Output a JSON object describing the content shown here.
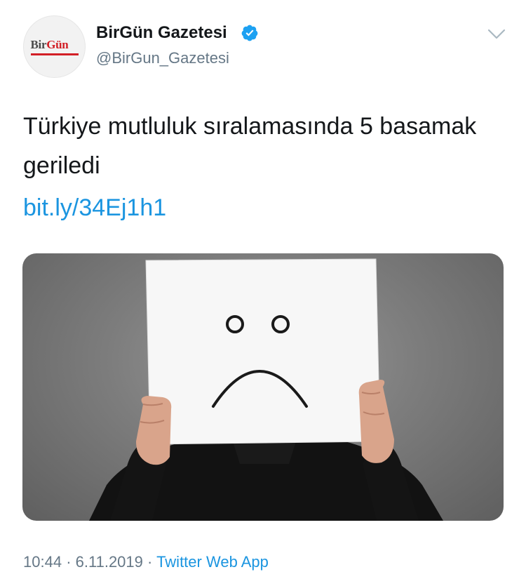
{
  "tweet": {
    "avatar": {
      "logo_text_dark": "Bir",
      "logo_text_red": "Gün",
      "accent_color": "#d21f26"
    },
    "author": {
      "display_name": "BirGün Gazetesi",
      "handle": "@BirGun_Gazetesi",
      "verified": true,
      "verified_icon": "verified-badge-icon",
      "verified_color": "#1da1f2"
    },
    "menu_icon": "chevron-down-icon",
    "text": "Türkiye mutluluk sıralamasında 5 basamak geriledi",
    "link": "bit.ly/34Ej1h1",
    "link_color": "#1b95e0",
    "media": {
      "sign_face_icon": "sad-face-icon"
    },
    "time": "10:44",
    "date": "6.11.2019",
    "separator": "·",
    "source": "Twitter Web App"
  }
}
